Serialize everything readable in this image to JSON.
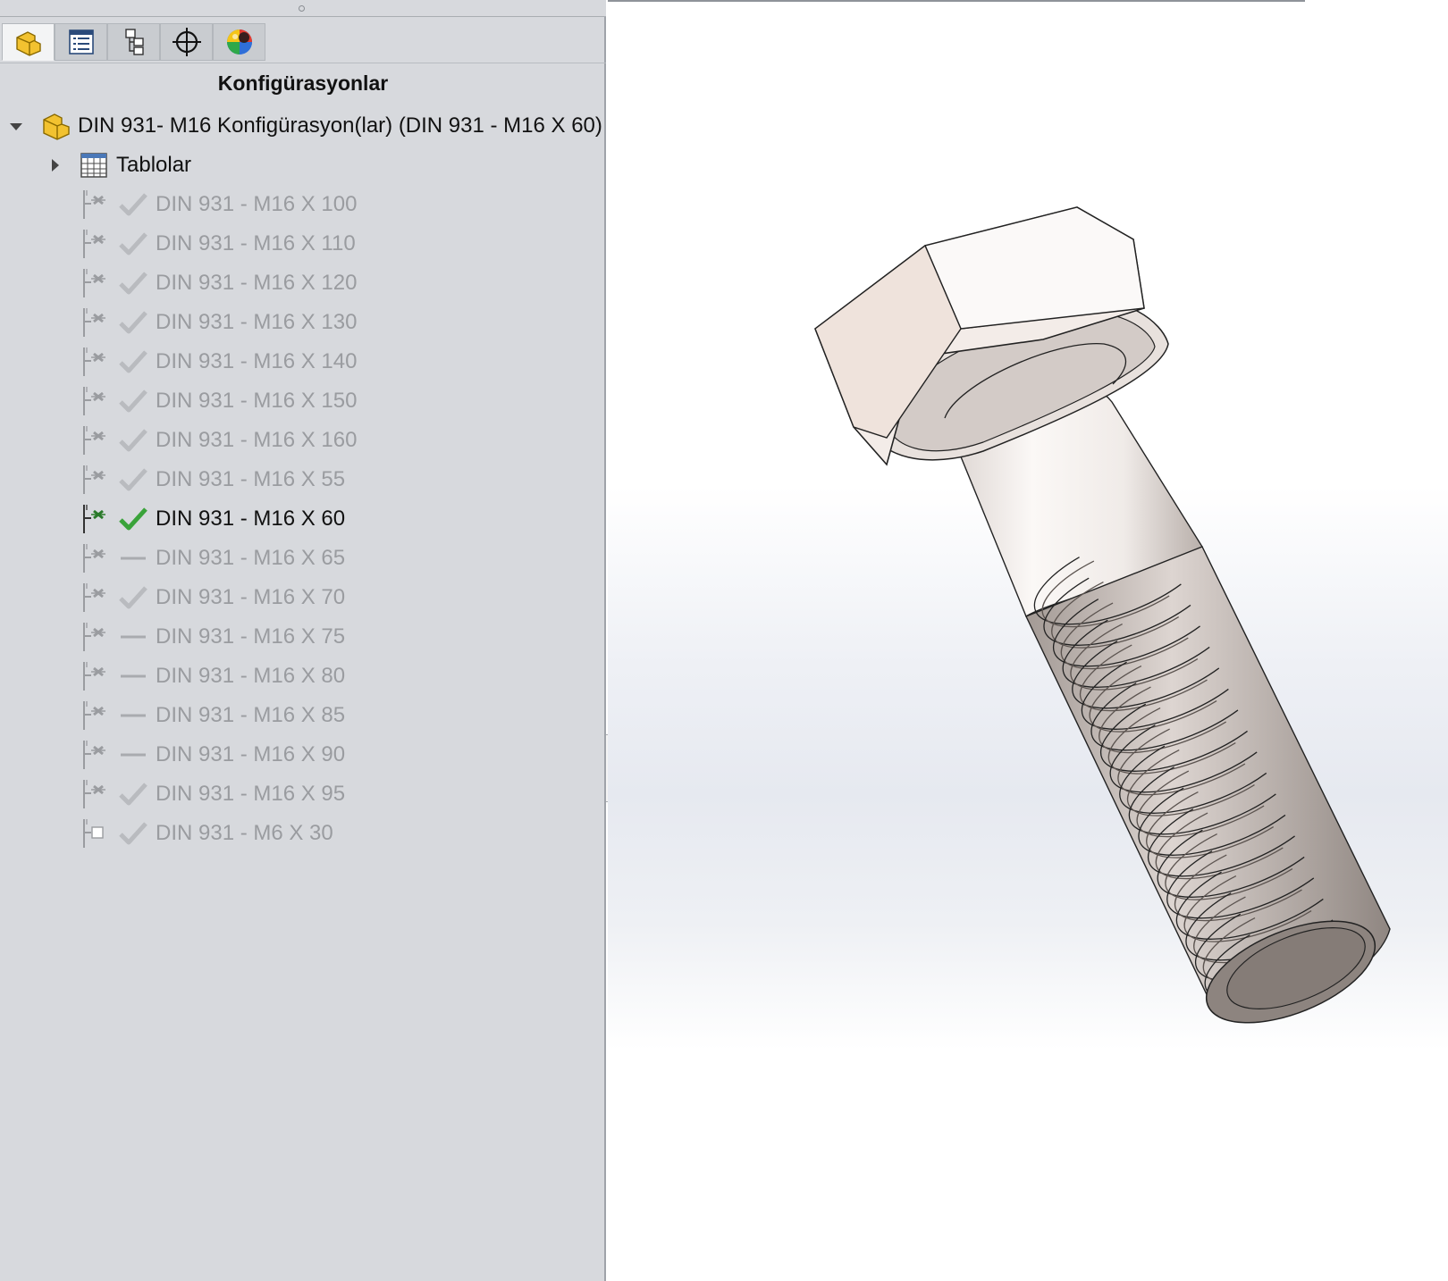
{
  "panel": {
    "title": "Konfigürasyonlar",
    "tabs": [
      {
        "name": "feature-manager",
        "icon": "part-icon",
        "active": true
      },
      {
        "name": "property-manager",
        "icon": "property-list-icon",
        "active": false
      },
      {
        "name": "configuration-manager",
        "icon": "configuration-tree-icon",
        "active": false
      },
      {
        "name": "dimxpert-manager",
        "icon": "crosshair-icon",
        "active": false
      },
      {
        "name": "display-manager",
        "icon": "appearance-sphere-icon",
        "active": false
      }
    ],
    "root": {
      "label": "DIN 931- M16 Konfigürasyon(lar)  (DIN 931 - M16 X 60)",
      "expanded": true
    },
    "tables_node": {
      "label": "Tablolar",
      "expanded": false
    },
    "configurations": [
      {
        "label": "DIN 931 - M16 X 100",
        "status": "check",
        "active": false
      },
      {
        "label": "DIN 931 - M16 X 110",
        "status": "check",
        "active": false
      },
      {
        "label": "DIN 931 - M16 X 120",
        "status": "check",
        "active": false
      },
      {
        "label": "DIN 931 - M16 X 130",
        "status": "check",
        "active": false
      },
      {
        "label": "DIN 931 - M16 X 140",
        "status": "check",
        "active": false
      },
      {
        "label": "DIN 931 - M16 X 150",
        "status": "check",
        "active": false
      },
      {
        "label": "DIN 931 - M16 X 160",
        "status": "check",
        "active": false
      },
      {
        "label": "DIN 931 - M16 X 55",
        "status": "check",
        "active": false
      },
      {
        "label": "DIN 931 - M16 X 60",
        "status": "check",
        "active": true
      },
      {
        "label": "DIN 931 - M16 X 65",
        "status": "dash",
        "active": false
      },
      {
        "label": "DIN 931 - M16 X 70",
        "status": "check",
        "active": false
      },
      {
        "label": "DIN 931 - M16 X 75",
        "status": "dash",
        "active": false
      },
      {
        "label": "DIN 931 - M16 X 80",
        "status": "dash",
        "active": false
      },
      {
        "label": "DIN 931 - M16 X 85",
        "status": "dash",
        "active": false
      },
      {
        "label": "DIN 931 - M16 X 90",
        "status": "dash",
        "active": false
      },
      {
        "label": "DIN 931 - M16 X 95",
        "status": "check",
        "active": false
      },
      {
        "label": "DIN 931 - M6 X 30",
        "status": "check",
        "active": false,
        "plain_icon": true
      }
    ]
  },
  "colors": {
    "panel_bg": "#d7d9dd",
    "active_check": "#3aa33a",
    "dim_check": "#b9bbbf",
    "dim_text": "#9a9ca0",
    "bolt_face": "#efe9e6"
  }
}
